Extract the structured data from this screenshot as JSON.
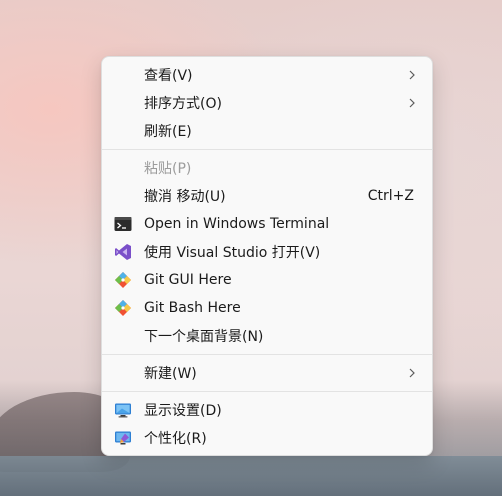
{
  "menu": {
    "items": [
      {
        "label": "查看(V)",
        "has_submenu": true,
        "disabled": false,
        "icon": ""
      },
      {
        "label": "排序方式(O)",
        "has_submenu": true,
        "disabled": false,
        "icon": ""
      },
      {
        "label": "刷新(E)",
        "has_submenu": false,
        "disabled": false,
        "icon": ""
      },
      {
        "label": "粘贴(P)",
        "has_submenu": false,
        "disabled": true,
        "icon": ""
      },
      {
        "label": "撤消 移动(U)",
        "shortcut": "Ctrl+Z",
        "has_submenu": false,
        "disabled": false,
        "icon": ""
      },
      {
        "label": "Open in Windows Terminal",
        "has_submenu": false,
        "disabled": false,
        "icon": "terminal-icon"
      },
      {
        "label": "使用 Visual Studio 打开(V)",
        "has_submenu": false,
        "disabled": false,
        "icon": "visual-studio-icon"
      },
      {
        "label": "Git GUI Here",
        "has_submenu": false,
        "disabled": false,
        "icon": "git-gui-icon"
      },
      {
        "label": "Git Bash Here",
        "has_submenu": false,
        "disabled": false,
        "icon": "git-bash-icon"
      },
      {
        "label": "下一个桌面背景(N)",
        "has_submenu": false,
        "disabled": false,
        "icon": ""
      },
      {
        "label": "新建(W)",
        "has_submenu": true,
        "disabled": false,
        "icon": ""
      },
      {
        "label": "显示设置(D)",
        "has_submenu": false,
        "disabled": false,
        "icon": "display-settings-icon"
      },
      {
        "label": "个性化(R)",
        "has_submenu": false,
        "disabled": false,
        "icon": "personalize-icon"
      }
    ]
  },
  "colors": {
    "menu_bg": "#f9f9f9",
    "text": "#1b1b1b",
    "disabled_text": "#9c9c9c",
    "separator": "#e3e3e3"
  }
}
